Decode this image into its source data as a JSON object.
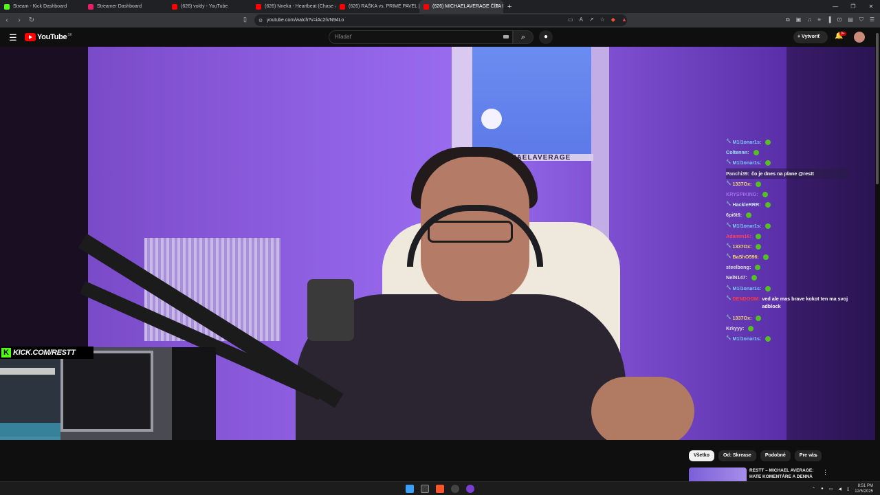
{
  "browser": {
    "tabs": [
      {
        "label": "Stream - Kick Dashboard",
        "color": "#53fc18"
      },
      {
        "label": "Streamer Dashboard",
        "color": "#e91e63"
      },
      {
        "label": "(626) voldy - YouTube",
        "color": "#ff0000"
      },
      {
        "label": "(626) Nneka - Heartbeat (Chase & St",
        "color": "#ff0000"
      },
      {
        "label": "(626) RAŠKA vs. PRIME PAVEL | Tváři",
        "color": "#ff0000"
      },
      {
        "label": "(626) MICHAELAVERAGE ČÍTA H",
        "color": "#ff0000"
      }
    ],
    "new_tab": "+",
    "url": "youtube.com/watch?v=iAc2iVN94Lo"
  },
  "youtube": {
    "logo": "YouTube",
    "country": "SK",
    "search_placeholder": "Hľadať",
    "create_label": "Vytvoriť",
    "notif_count": "9+"
  },
  "overlay": {
    "kick_handle": "KICK.COM/RESTT",
    "brand_text": "MICHAELAVERAGE"
  },
  "chat": [
    {
      "badge": "🔧",
      "name": "M1l1onar1s:",
      "color": "#7cc7ff",
      "text": ""
    },
    {
      "badge": "",
      "name": "Coltennn:",
      "color": "#9fe8ff",
      "text": ""
    },
    {
      "badge": "🔧",
      "name": "M1l1onar1s:",
      "color": "#7cc7ff",
      "text": ""
    },
    {
      "badge": "",
      "name": "Panchi39:",
      "color": "#e0e0e0",
      "text": "čo je dnes na plane @restt"
    },
    {
      "badge": "🔧",
      "name": "1337Ox:",
      "color": "#f5d76e",
      "text": ""
    },
    {
      "badge": "",
      "name": "KRYSPIKING:",
      "color": "#a46cf0",
      "text": ""
    },
    {
      "badge": "🔧",
      "name": "HackleRRR:",
      "color": "#c8e6ff",
      "text": ""
    },
    {
      "badge": "",
      "name": "6pi6t6:",
      "color": "#e0e0e0",
      "text": ""
    },
    {
      "badge": "🔧",
      "name": "M1l1onar1s:",
      "color": "#7cc7ff",
      "text": ""
    },
    {
      "badge": "",
      "name": "Adamin16:",
      "color": "#ff4060",
      "text": ""
    },
    {
      "badge": "🔧",
      "name": "1337Ox:",
      "color": "#f5d76e",
      "text": ""
    },
    {
      "badge": "🔧",
      "name": "BaShO596:",
      "color": "#f5d76e",
      "text": ""
    },
    {
      "badge": "",
      "name": "steelbong:",
      "color": "#e0e0e0",
      "text": ""
    },
    {
      "badge": "",
      "name": "NelN147:",
      "color": "#e0e0e0",
      "text": ""
    },
    {
      "badge": "🔧",
      "name": "M1l1onar1s:",
      "color": "#7cc7ff",
      "text": ""
    },
    {
      "badge": "🔧",
      "name": "DENDOOM:",
      "color": "#ff3a3a",
      "text": "ved ale mas brave kokot ten ma svoj adblock"
    },
    {
      "badge": "🔧",
      "name": "1337Ox:",
      "color": "#f5d76e",
      "text": ""
    },
    {
      "badge": "",
      "name": "Krkyyy:",
      "color": "#e0e0e0",
      "text": ""
    },
    {
      "badge": "🔧",
      "name": "M1l1onar1s:",
      "color": "#7cc7ff",
      "text": ""
    }
  ],
  "related": {
    "chips": [
      "Všetko",
      "Od: Skrease",
      "Podobné",
      "Pre vás"
    ],
    "video_title": "RESTT – MICHAEL AVERAGE: HATE KOMENTÁRE A DENNÁ"
  },
  "taskbar": {
    "time": "8:51 PM",
    "date": "12/5/2025"
  }
}
